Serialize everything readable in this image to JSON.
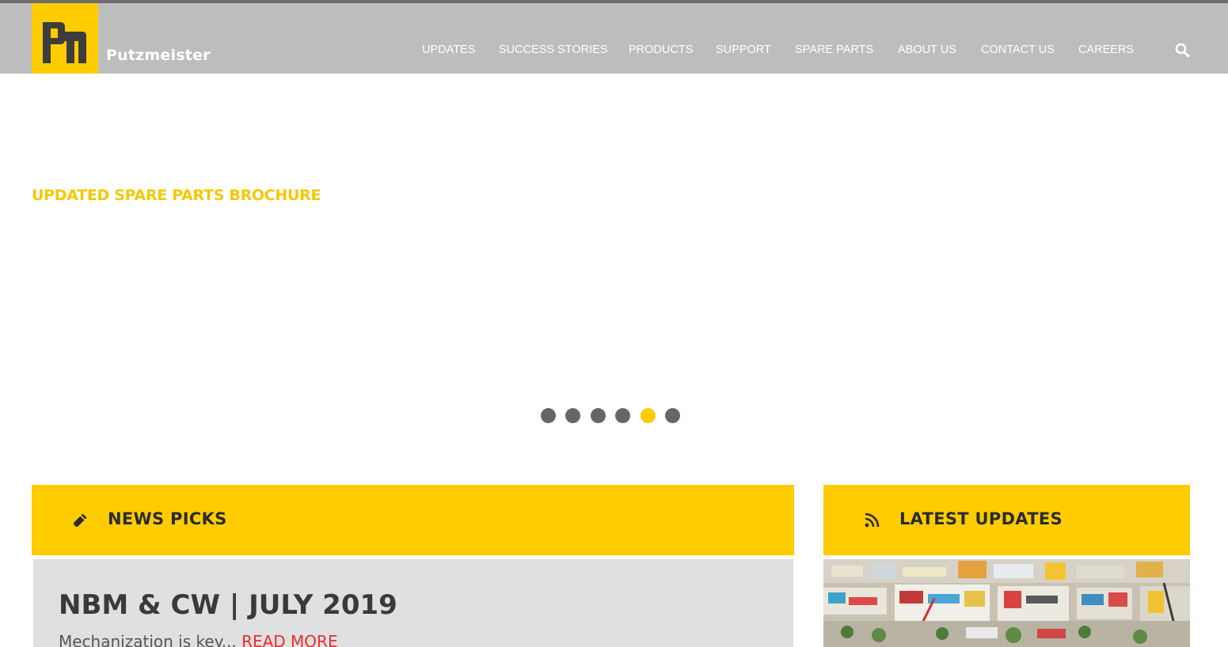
{
  "brand": {
    "name": "Putzmeister",
    "color_yellow": "#ffcc00",
    "color_header": "#bdbdbd"
  },
  "nav": {
    "items": [
      {
        "label": "UPDATES"
      },
      {
        "label": "SUCCESS STORIES"
      },
      {
        "label": "PRODUCTS"
      },
      {
        "label": "SUPPORT"
      },
      {
        "label": "SPARE PARTS"
      },
      {
        "label": "ABOUT US"
      },
      {
        "label": "CONTACT US"
      },
      {
        "label": "CAREERS"
      }
    ],
    "search_icon": "search-icon"
  },
  "hero": {
    "title": "UPDATED SPARE PARTS BROCHURE",
    "slide_count": 6,
    "active_slide": 5
  },
  "news_picks": {
    "header": "NEWS PICKS",
    "icon": "pencil-icon",
    "article_title": "NBM & CW | JULY 2019",
    "excerpt": "Mechanization is key...",
    "read_more": "READ MORE"
  },
  "latest_updates": {
    "header": "LATEST UPDATES",
    "icon": "rss-icon"
  }
}
